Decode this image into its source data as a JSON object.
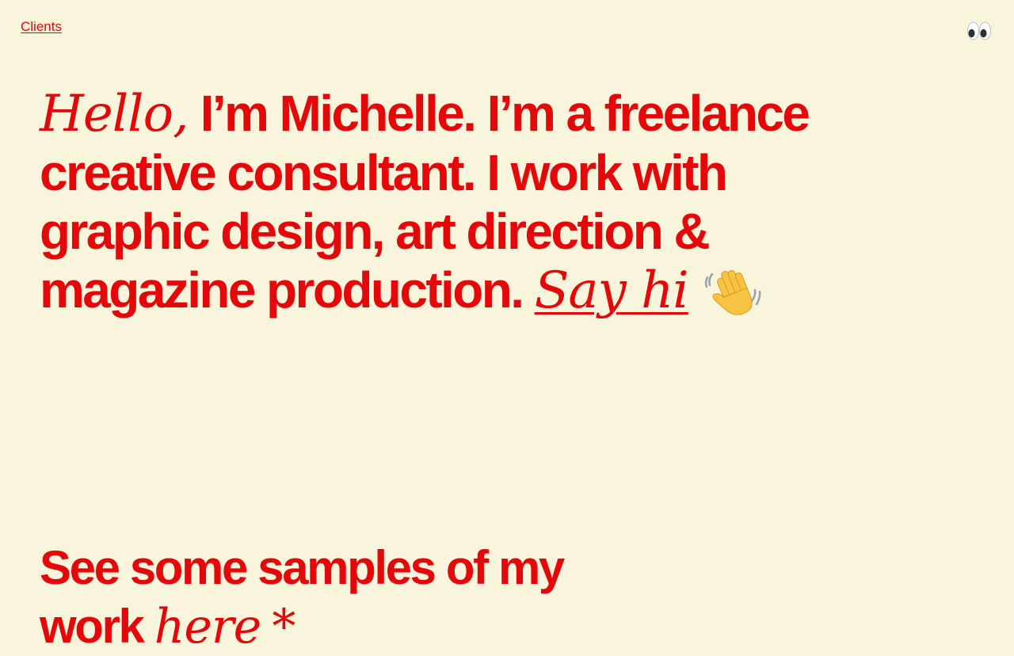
{
  "nav": {
    "clients_label": "Clients",
    "eyes_icon": "eyes-icon"
  },
  "hero": {
    "greeting": "Hello,",
    "text_line": "I’m Michelle. I’m a freelance creative consultant. I work with graphic design, art direction & magazine production.",
    "cta_label": "Say hi",
    "wave_icon": "waving-hand-icon"
  },
  "samples": {
    "text": "See some samples of my work",
    "link_label": "here",
    "asterisk": "*"
  },
  "colors": {
    "background": "#f9f4dc",
    "accent": "#e4080a"
  }
}
